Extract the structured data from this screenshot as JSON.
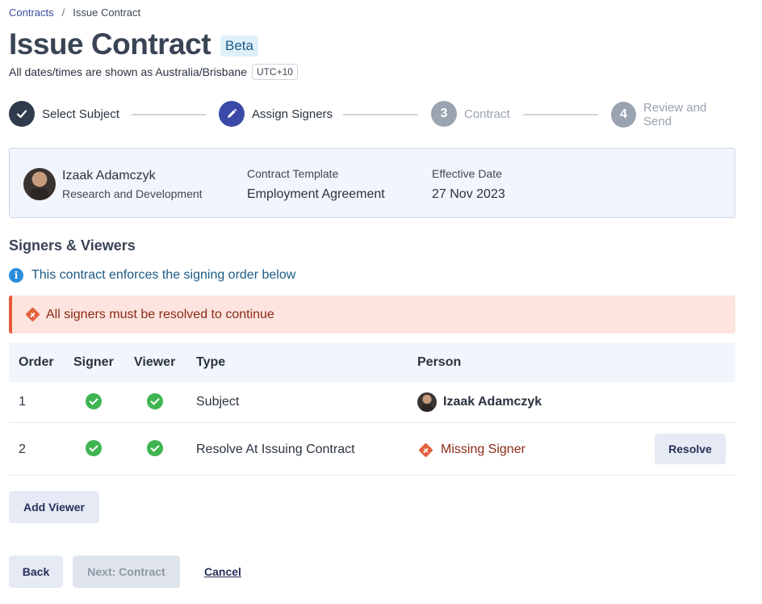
{
  "breadcrumb": {
    "parent": "Contracts",
    "separator": "/",
    "current": "Issue Contract"
  },
  "header": {
    "title": "Issue Contract",
    "badge": "Beta",
    "timezone_text": "All dates/times are shown as Australia/Brisbane",
    "timezone_badge": "UTC+10"
  },
  "stepper": {
    "steps": [
      {
        "number": "",
        "label": "Select Subject",
        "state": "done"
      },
      {
        "number": "",
        "label": "Assign Signers",
        "state": "active"
      },
      {
        "number": "3",
        "label": "Contract",
        "state": "todo"
      },
      {
        "number": "4",
        "label": "Review and Send",
        "state": "todo"
      }
    ]
  },
  "summary": {
    "name": "Izaak Adamczyk",
    "department": "Research and Development",
    "template_label": "Contract Template",
    "template_value": "Employment Agreement",
    "date_label": "Effective Date",
    "date_value": "27 Nov 2023"
  },
  "signers": {
    "title": "Signers & Viewers",
    "info": "This contract enforces the signing order below",
    "alert": "All signers must be resolved to continue",
    "columns": {
      "order": "Order",
      "signer": "Signer",
      "viewer": "Viewer",
      "type": "Type",
      "person": "Person"
    },
    "rows": [
      {
        "order": "1",
        "type": "Subject",
        "person": "Izaak Adamczyk"
      },
      {
        "order": "2",
        "type": "Resolve At Issuing Contract",
        "person": "Missing Signer",
        "action": "Resolve"
      }
    ]
  },
  "actions": {
    "add_viewer": "Add Viewer",
    "back": "Back",
    "next": "Next: Contract",
    "cancel": "Cancel"
  },
  "colors": {
    "primary": "#3b4aa6",
    "success": "#3fb551",
    "danger": "#e2603e",
    "info": "#2e8ddc"
  }
}
